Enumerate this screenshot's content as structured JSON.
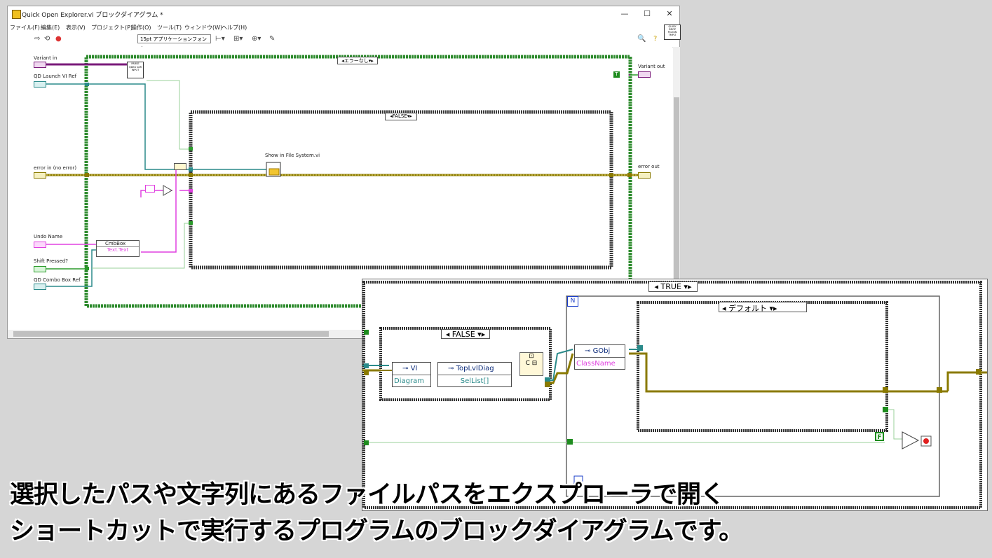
{
  "window": {
    "title": "Quick Open Explorer.vi ブロックダイアグラム *",
    "minimize": "—",
    "maximize": "☐",
    "close": "✕"
  },
  "menu": [
    "ファイル(F)",
    "編集(E)",
    "表示(V)",
    "プロジェクト(P)",
    "操作(O)",
    "ツール(T)",
    "ウィンドウ(W)",
    "ヘルプ(H)"
  ],
  "toolbar": {
    "font": "15pt アプリケーションフォント",
    "qd_badge": "QUICK DROP PLUGIN TMPLT"
  },
  "diagram": {
    "terminals": {
      "variant_in": "Variant in",
      "qd_launch_vi_ref": "QD Launch VI Ref",
      "error_in": "error in (no error)",
      "undo_name": "Undo Name",
      "shift_pressed": "Shift Pressed?",
      "qd_combo_box_ref": "QD Combo Box Ref",
      "variant_out": "Variant out",
      "error_out": "error out"
    },
    "error_case_selector": "エラーなし",
    "false_case_selector": "FALSE",
    "parse_node": "PARSE QDKS VAR INPUT",
    "subvi_label": "Show in File System.vi",
    "cmbbox_node": "CmbBox",
    "cmbbox_prop": "Text.Text",
    "true_const": "T"
  },
  "inset": {
    "true_case_selector": "TRUE",
    "inner_false_selector": "FALSE",
    "default_case_selector": "デフォルト",
    "vi_node": "VI",
    "vi_prop": "Diagram",
    "toplvl_node": "TopLvlDiag",
    "toplvl_prop": "SelList[]",
    "gobj_node": "GObj",
    "gobj_prop": "ClassName",
    "false_const": "F",
    "n_label": "N"
  },
  "caption": {
    "line1": "選択したパスや文字列にあるファイルパスをエクスプローラで開く",
    "line2": "ショートカットで実行するプログラムのブロックダイアグラムです。"
  }
}
